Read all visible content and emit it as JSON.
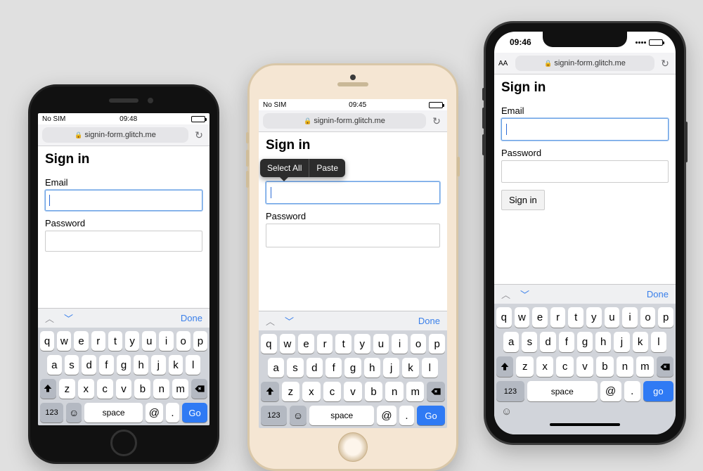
{
  "url_host": "signin-form.glitch.me",
  "page": {
    "title": "Sign in",
    "email_label": "Email",
    "password_label": "Password",
    "signin_button": "Sign in"
  },
  "popover": {
    "select_all": "Select All",
    "paste": "Paste"
  },
  "kb_accessory": {
    "done": "Done"
  },
  "keyboard_rows": {
    "r1": [
      "q",
      "w",
      "e",
      "r",
      "t",
      "y",
      "u",
      "i",
      "o",
      "p"
    ],
    "r2": [
      "a",
      "s",
      "d",
      "f",
      "g",
      "h",
      "j",
      "k",
      "l"
    ],
    "r3": [
      "z",
      "x",
      "c",
      "v",
      "b",
      "n",
      "m"
    ],
    "numkey": "123",
    "space": "space",
    "at": "@",
    "dot": ".",
    "go1": "Go",
    "go3": "go"
  },
  "status": {
    "p1": {
      "carrier": "No SIM",
      "time": "09:48"
    },
    "p2": {
      "carrier": "No SIM",
      "time": "09:45"
    },
    "p3": {
      "time": "09:46",
      "aa": "AA"
    }
  }
}
